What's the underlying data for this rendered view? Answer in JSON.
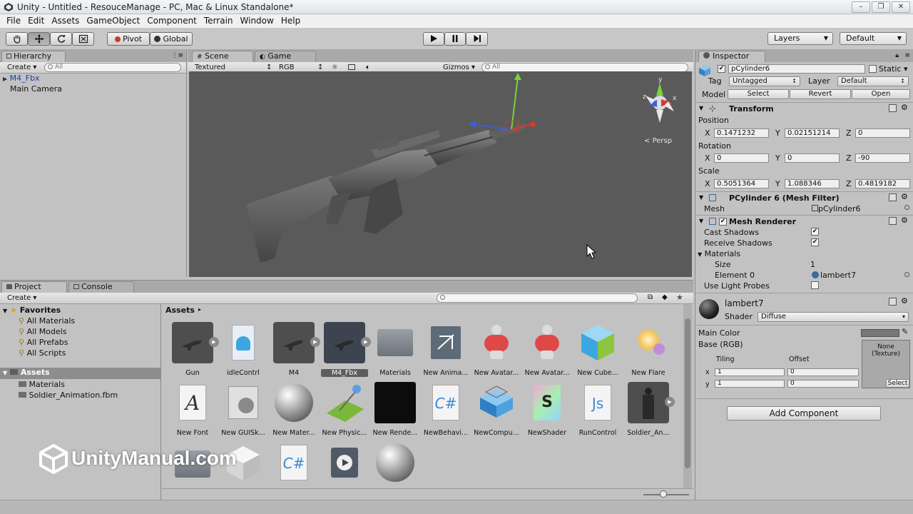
{
  "window": {
    "title": "Unity - Untitled - ResouceManage - PC, Mac & Linux Standalone*",
    "controls": [
      "–",
      "❐",
      "✕"
    ]
  },
  "menu": [
    "File",
    "Edit",
    "Assets",
    "GameObject",
    "Component",
    "Terrain",
    "Window",
    "Help"
  ],
  "toolbar": {
    "pivot": "Pivot",
    "global": "Global",
    "layers": "Layers",
    "layout": "Default"
  },
  "hierarchy": {
    "tab": "Hierarchy",
    "create": "Create",
    "search_placeholder": "All",
    "items": [
      "M4_Fbx",
      "Main Camera"
    ]
  },
  "scene": {
    "tab_scene": "Scene",
    "tab_game": "Game",
    "render_mode": "Textured",
    "color_mode": "RGB",
    "gizmos": "Gizmos",
    "search_placeholder": "All",
    "persp_label": "Persp",
    "axis_labels": {
      "x": "x",
      "y": "y",
      "z": "z"
    }
  },
  "project": {
    "tab_project": "Project",
    "tab_console": "Console",
    "create": "Create",
    "breadcrumb": "Assets",
    "favorites_label": "Favorites",
    "favorites": [
      "All Materials",
      "All Models",
      "All Prefabs",
      "All Scripts"
    ],
    "assets_label": "Assets",
    "folders": [
      "Materials",
      "Soldier_Animation.fbm"
    ],
    "assets": [
      {
        "label": "Gun"
      },
      {
        "label": "idleContrl"
      },
      {
        "label": "M4"
      },
      {
        "label": "M4_Fbx"
      },
      {
        "label": "Materials"
      },
      {
        "label": "New Anima..."
      },
      {
        "label": "New Avatar..."
      },
      {
        "label": "New Avatar..."
      },
      {
        "label": "New Cube..."
      },
      {
        "label": "New Flare"
      },
      {
        "label": "New Font"
      },
      {
        "label": "New GUISk..."
      },
      {
        "label": "New Mater..."
      },
      {
        "label": "New Physic..."
      },
      {
        "label": "New Rende..."
      },
      {
        "label": "NewBehavi..."
      },
      {
        "label": "NewCompu..."
      },
      {
        "label": "NewShader"
      },
      {
        "label": "RunControl"
      },
      {
        "label": "Soldier_An..."
      }
    ]
  },
  "inspector": {
    "tab": "Inspector",
    "object_name": "pCylinder6",
    "static_label": "Static",
    "tag_label": "Tag",
    "tag_value": "Untagged",
    "layer_label": "Layer",
    "layer_value": "Default",
    "model_label": "Model",
    "model_select": "Select",
    "model_revert": "Revert",
    "model_open": "Open",
    "transform": {
      "title": "Transform",
      "position_label": "Position",
      "position": {
        "x": "0.1471232",
        "y": "0.02151214",
        "z": "0"
      },
      "rotation_label": "Rotation",
      "rotation": {
        "x": "0",
        "y": "0",
        "z": "-90"
      },
      "scale_label": "Scale",
      "scale": {
        "x": "0.5051364",
        "y": "1.088346",
        "z": "0.4819182"
      }
    },
    "axis": {
      "x": "X",
      "y": "Y",
      "z": "Z"
    },
    "mesh_filter": {
      "title": "PCylinder 6 (Mesh Filter)",
      "mesh_label": "Mesh",
      "mesh_value": "pCylinder6"
    },
    "mesh_renderer": {
      "title": "Mesh Renderer",
      "cast_shadows": "Cast Shadows",
      "receive_shadows": "Receive Shadows",
      "materials": "Materials",
      "size_label": "Size",
      "size_value": "1",
      "element0_label": "Element 0",
      "element0_value": "lambert7",
      "light_probes": "Use Light Probes"
    },
    "material": {
      "name": "lambert7",
      "shader_label": "Shader",
      "shader_value": "Diffuse",
      "main_color": "Main Color",
      "base": "Base (RGB)",
      "tiling": "Tiling",
      "offset": "Offset",
      "tx": "x",
      "ty": "y",
      "tiling_x": "1",
      "tiling_y": "1",
      "offset_x": "0",
      "offset_y": "0",
      "texture_none": "None\n(Texture)",
      "texture_select": "Select"
    },
    "add_component": "Add Component"
  },
  "watermark": "UnityManual.com"
}
